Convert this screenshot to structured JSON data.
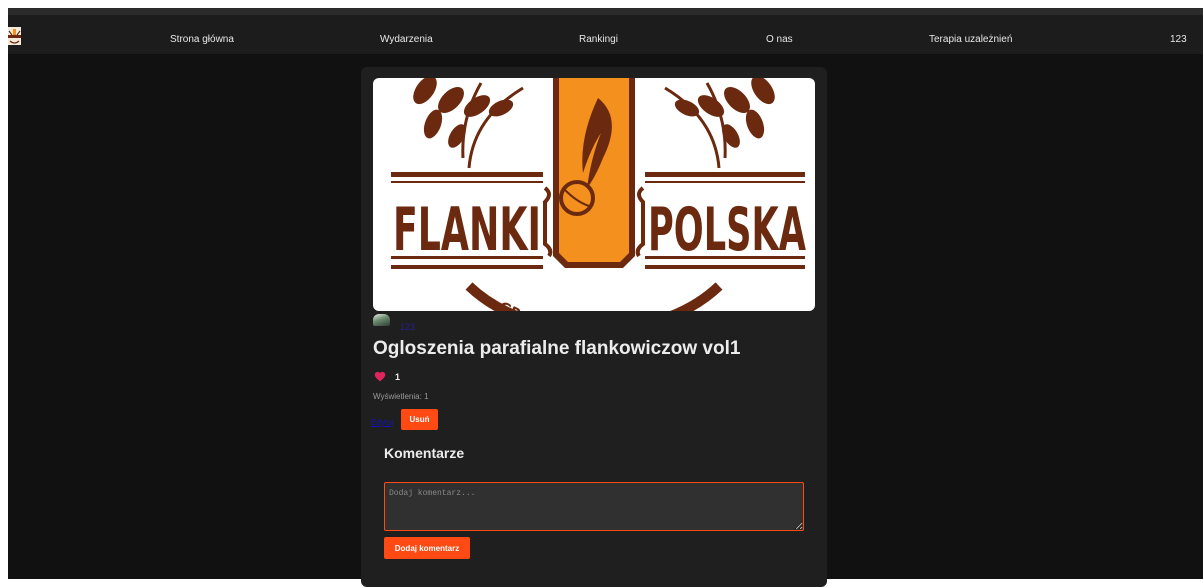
{
  "nav": {
    "items": [
      {
        "label": "Strona główna"
      },
      {
        "label": "Wydarzenia"
      },
      {
        "label": "Rankingi"
      },
      {
        "label": "O nas"
      },
      {
        "label": "Terapia uzależnień"
      }
    ],
    "user": "123"
  },
  "post": {
    "image": {
      "logo_left": "FLANKI",
      "logo_right": "POLSKA",
      "logo_bottom": "GRO ŚCI",
      "brand_brown": "#6b2a10",
      "brand_orange": "#f4901e"
    },
    "author": "123",
    "title": "Ogloszenia parafialne flankowiczow vol1",
    "likes": "1",
    "views_label": "Wyświetlenia:",
    "views_value": "1",
    "edit_label": "Edytuj",
    "delete_label": "Usuń"
  },
  "comments": {
    "title": "Komentarze",
    "placeholder": "Dodaj komentarz...",
    "submit_label": "Dodaj komentarz"
  },
  "colors": {
    "accent": "#ff4a14",
    "background": "#111111",
    "card": "#1f1f1f",
    "heart": "#e0245e"
  }
}
